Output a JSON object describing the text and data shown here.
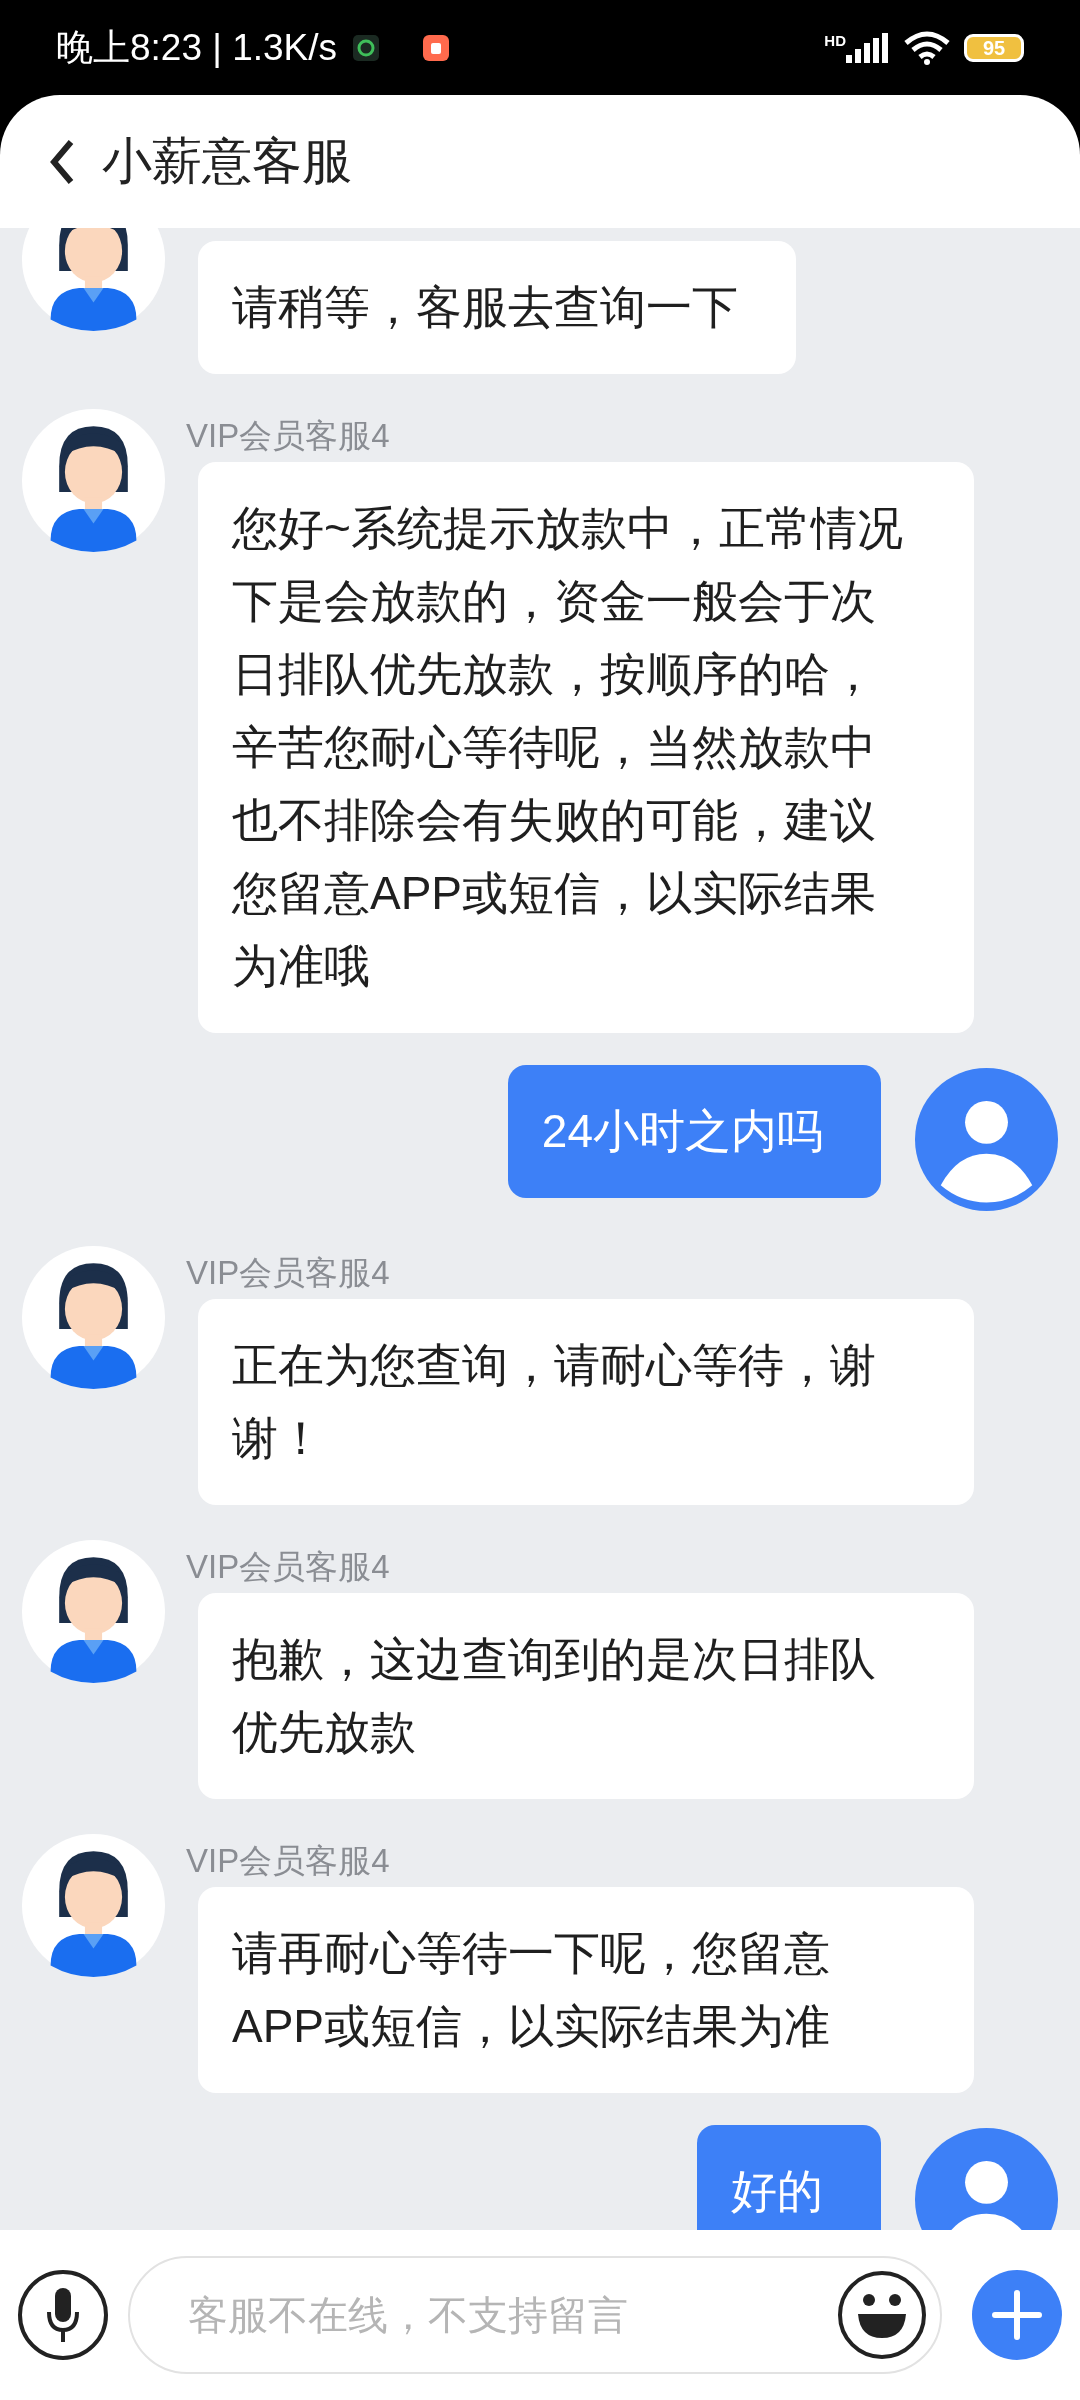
{
  "status_bar": {
    "time": "晚上8:23 | 1.3K/s",
    "network_type": "HD",
    "battery": "95"
  },
  "header": {
    "title": "小薪意客服"
  },
  "messages": [
    {
      "kind": "agent",
      "text": "请稍等，客服去查询一下"
    },
    {
      "kind": "agent",
      "name": "VIP会员客服4",
      "text": "您好~系统提示放款中，正常情况下是会放款的，资金一般会于次日排队优先放款，按顺序的哈，辛苦您耐心等待呢，当然放款中也不排除会有失败的可能，建议您留意APP或短信，以实际结果为准哦"
    },
    {
      "kind": "user",
      "text": "24小时之内吗"
    },
    {
      "kind": "agent",
      "name": "VIP会员客服4",
      "text": "正在为您查询，请耐心等待，谢谢！"
    },
    {
      "kind": "agent",
      "name": "VIP会员客服4",
      "text": "抱歉，这边查询到的是次日排队优先放款"
    },
    {
      "kind": "agent",
      "name": "VIP会员客服4",
      "text": "请再耐心等待一下呢，您留意APP或短信，以实际结果为准"
    },
    {
      "kind": "user",
      "text": "好的"
    }
  ],
  "input": {
    "placeholder": "客服不在线，不支持留言"
  }
}
